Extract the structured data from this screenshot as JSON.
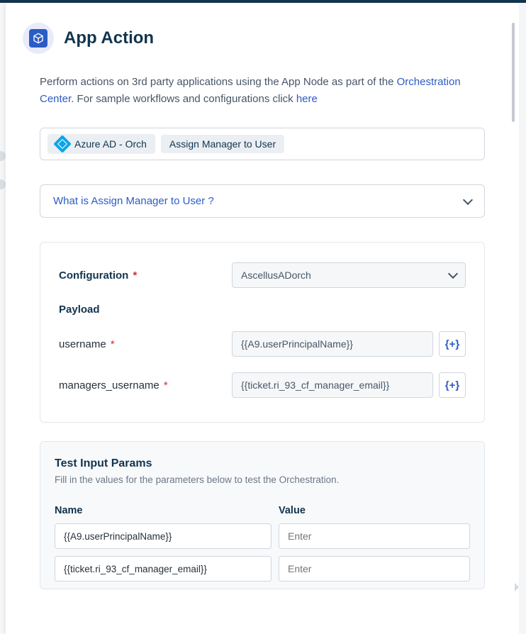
{
  "header": {
    "title": "App Action"
  },
  "description": {
    "before_link1": "Perform actions on 3rd party applications using the App Node as part of the ",
    "link1": "Orchestration Center",
    "mid": ". For sample workflows and configurations click ",
    "link2": "here"
  },
  "breadcrumb_pills": {
    "app": "Azure AD - Orch",
    "action": "Assign Manager to User"
  },
  "accordion_title": "What is Assign Manager to User ?",
  "form": {
    "configuration_label": "Configuration",
    "configuration_value": "AscellusADorch",
    "payload_heading": "Payload",
    "fields": [
      {
        "label": "username",
        "value": "{{A9.userPrincipalName}}"
      },
      {
        "label": "managers_username",
        "value": "{{ticket.ri_93_cf_manager_email}}"
      }
    ],
    "insert_btn": "{+}"
  },
  "test_panel": {
    "title": "Test Input Params",
    "subtitle": "Fill in the values for the parameters below to test the Orchestration.",
    "col_name": "Name",
    "col_value": "Value",
    "rows": [
      {
        "name": "{{A9.userPrincipalName}}",
        "placeholder": "Enter"
      },
      {
        "name": "{{ticket.ri_93_cf_manager_email}}",
        "placeholder": "Enter"
      }
    ]
  }
}
